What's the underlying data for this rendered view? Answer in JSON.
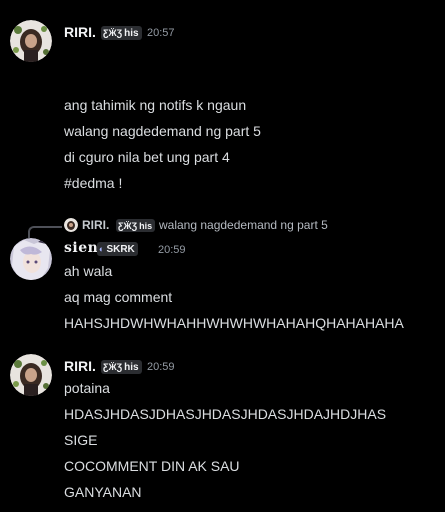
{
  "messages": [
    {
      "author": "RIRI.",
      "tag": "his",
      "tag_icon": "butterfly-icon",
      "time": "20:57",
      "lines": [
        "ang tahimik ng notifs k ngaun",
        "walang nagdedemand ng part 5",
        "di cguro nila bet ung part 4",
        "#dedma !"
      ]
    },
    {
      "reply": {
        "author": "RIRI.",
        "tag": "his",
        "text": "walang nagdedemand ng part 5"
      },
      "author": "sien",
      "tag": "SKRK",
      "tag_icon": "crescent-moon-icon",
      "time": "20:59",
      "lines": [
        "ah wala",
        "aq mag comment",
        "HAHSJHDWHWHAHHWHWHWHAHAHQHAHAHAHA"
      ]
    },
    {
      "author": "RIRI.",
      "tag": "his",
      "tag_icon": "butterfly-icon",
      "time": "20:59",
      "lines": [
        "potaina",
        "HDASJHDASJDHASJHDASJHDASJHDAJHDJHAS",
        "SIGE",
        "COCOMMENT DIN AK SAU",
        "GANYANAN"
      ]
    }
  ],
  "colors": {
    "background": "#000000",
    "text": "#dbdee1",
    "author": "#f2f3f5",
    "timestamp": "#949ba4",
    "tag_bg": "#2b2d31"
  }
}
